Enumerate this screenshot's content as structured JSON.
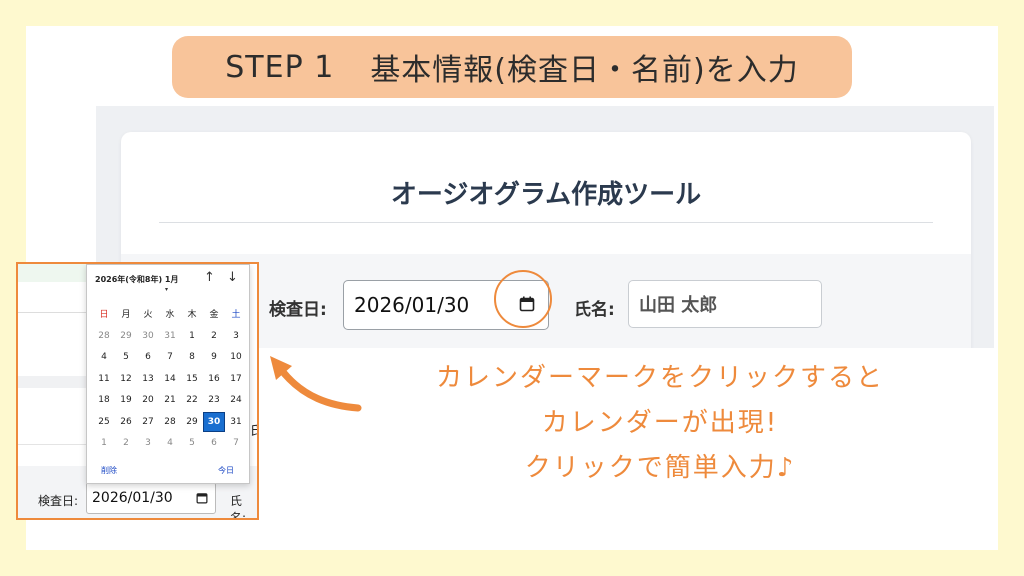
{
  "banner": {
    "step": "STEP 1",
    "text": "基本情報(検査日・名前)を入力"
  },
  "app": {
    "title": "オージオグラム作成ツール",
    "date_label": "検査日:",
    "date_value": "2026/01/30",
    "name_label": "氏名:",
    "name_value": "山田 太郎"
  },
  "callout": {
    "line1": "カレンダーマークをクリックすると",
    "line2": "カレンダーが出現!",
    "line3": "クリックで簡単入力♪"
  },
  "inset": {
    "partial_label": "氏",
    "date_label": "検査日:",
    "date_value": "2026/01/30",
    "name_label": "氏名:"
  },
  "picker": {
    "month_label": "2026年(令和8年) 1月",
    "caret": "▾",
    "nav_up": "↑",
    "nav_down": "↓",
    "weekdays": [
      "日",
      "月",
      "火",
      "水",
      "木",
      "金",
      "土"
    ],
    "weeks": [
      [
        "28",
        "29",
        "30",
        "31",
        "1",
        "2",
        "3"
      ],
      [
        "4",
        "5",
        "6",
        "7",
        "8",
        "9",
        "10"
      ],
      [
        "11",
        "12",
        "13",
        "14",
        "15",
        "16",
        "17"
      ],
      [
        "18",
        "19",
        "20",
        "21",
        "22",
        "23",
        "24"
      ],
      [
        "25",
        "26",
        "27",
        "28",
        "29",
        "30",
        "31"
      ],
      [
        "1",
        "2",
        "3",
        "4",
        "5",
        "6",
        "7"
      ]
    ],
    "selected_day": "30",
    "clear_label": "削除",
    "today_label": "今日"
  },
  "colors": {
    "accent_orange": "#ee8a3c",
    "banner_fill": "#f8c49a",
    "selected_day": "#1a6fd0",
    "sunday": "#d93025",
    "saturday": "#1a47c4"
  }
}
